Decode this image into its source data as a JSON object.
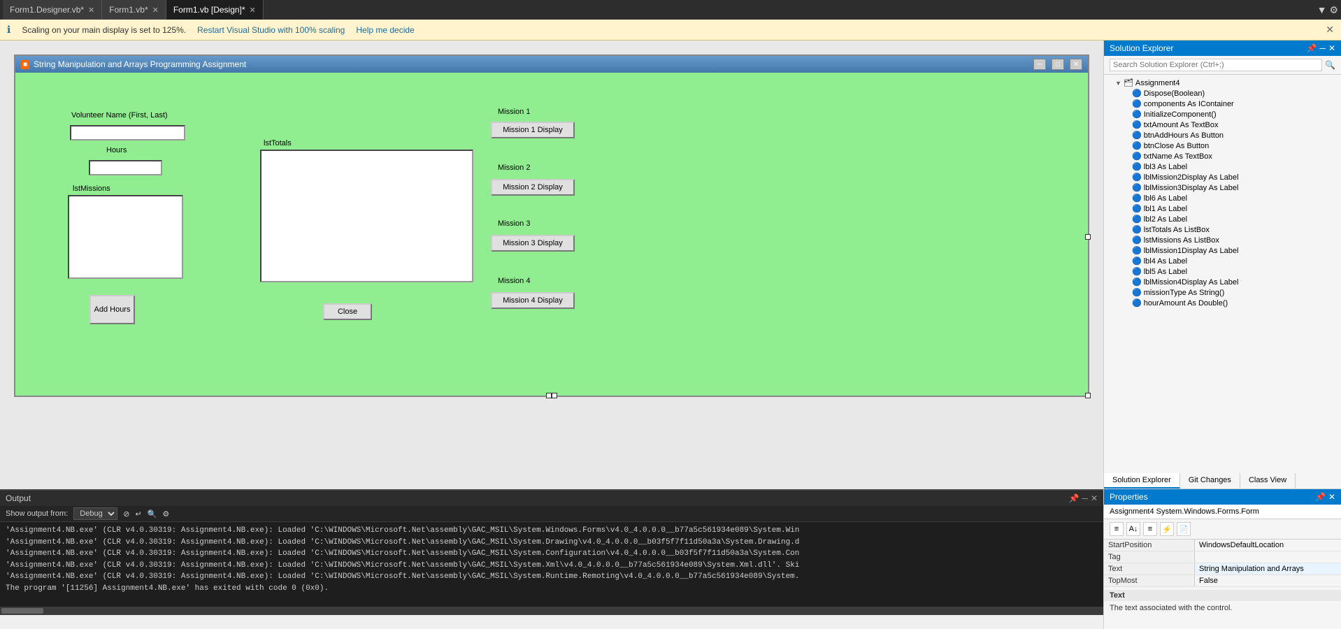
{
  "tabs": [
    {
      "label": "Form1.Designer.vb*",
      "active": false
    },
    {
      "label": "Form1.vb*",
      "active": false
    },
    {
      "label": "Form1.vb [Design]*",
      "active": true
    }
  ],
  "info_bar": {
    "message": "Scaling on your main display is set to 125%.",
    "link1": "Restart Visual Studio with 100% scaling",
    "link2": "Help me decide"
  },
  "form_window": {
    "title": "String Manipulation and Arrays Programming Assignment",
    "icon": "🟧"
  },
  "form_controls": {
    "volunteer_name_label": "Volunteer Name (First, Last)",
    "hours_label": "Hours",
    "lstMissions_label": "lstMissions",
    "lstTotals_label": "lstTotals",
    "mission1_label": "Mission 1",
    "mission2_label": "Mission 2",
    "mission3_label": "Mission 3",
    "mission4_label": "Mission 4",
    "mission1_btn": "Mission 1 Display",
    "mission2_btn": "Mission 2 Display",
    "mission3_btn": "Mission 3 Display",
    "mission4_btn": "Mission 4 Display",
    "add_hours_btn": "Add Hours",
    "close_btn": "Close"
  },
  "solution_explorer": {
    "title": "Solution Explorer",
    "search_placeholder": "Search Solution Explorer (Ctrl+;)",
    "tree_items": [
      {
        "label": "Assignment4",
        "indent": 1,
        "icon": "▶",
        "type": "solution"
      },
      {
        "label": "Dispose(Boolean)",
        "indent": 3,
        "icon": "🔵",
        "type": "method"
      },
      {
        "label": "components As IContainer",
        "indent": 3,
        "icon": "🔵",
        "type": "field"
      },
      {
        "label": "InitializeComponent()",
        "indent": 3,
        "icon": "🔵",
        "type": "method"
      },
      {
        "label": "txtAmount As TextBox",
        "indent": 3,
        "icon": "🔵",
        "type": "field"
      },
      {
        "label": "btnAddHours As Button",
        "indent": 3,
        "icon": "🔵",
        "type": "field"
      },
      {
        "label": "btnClose As Button",
        "indent": 3,
        "icon": "🔵",
        "type": "field"
      },
      {
        "label": "txtName As TextBox",
        "indent": 3,
        "icon": "🔵",
        "type": "field"
      },
      {
        "label": "lbl3 As Label",
        "indent": 3,
        "icon": "🔵",
        "type": "field"
      },
      {
        "label": "lblMission2Display As Label",
        "indent": 3,
        "icon": "🔵",
        "type": "field"
      },
      {
        "label": "lblMission3Display As Label",
        "indent": 3,
        "icon": "🔵",
        "type": "field"
      },
      {
        "label": "lbl6 As Label",
        "indent": 3,
        "icon": "🔵",
        "type": "field"
      },
      {
        "label": "lbl1 As Label",
        "indent": 3,
        "icon": "🔵",
        "type": "field"
      },
      {
        "label": "lbl2 As Label",
        "indent": 3,
        "icon": "🔵",
        "type": "field"
      },
      {
        "label": "lstTotals As ListBox",
        "indent": 3,
        "icon": "🔵",
        "type": "field"
      },
      {
        "label": "lstMissions As ListBox",
        "indent": 3,
        "icon": "🔵",
        "type": "field"
      },
      {
        "label": "lblMission1Display As Label",
        "indent": 3,
        "icon": "🔵",
        "type": "field"
      },
      {
        "label": "lbl4 As Label",
        "indent": 3,
        "icon": "🔵",
        "type": "field"
      },
      {
        "label": "lbl5 As Label",
        "indent": 3,
        "icon": "🔵",
        "type": "field"
      },
      {
        "label": "lblMission4Display As Label",
        "indent": 3,
        "icon": "🔵",
        "type": "field"
      },
      {
        "label": "missionType As String()",
        "indent": 3,
        "icon": "🔵",
        "type": "field"
      },
      {
        "label": "hourAmount As Double()",
        "indent": 3,
        "icon": "🔵",
        "type": "field"
      }
    ]
  },
  "panel_tabs": [
    {
      "label": "Solution Explorer",
      "active": true
    },
    {
      "label": "Git Changes",
      "active": false
    },
    {
      "label": "Class View",
      "active": false
    }
  ],
  "properties": {
    "title": "Properties",
    "object_name": "Assignment4  System.Windows.Forms.Form",
    "rows": [
      {
        "name": "StartPosition",
        "value": "WindowsDefaultLocation"
      },
      {
        "name": "Tag",
        "value": ""
      },
      {
        "name": "Text",
        "value": "String Manipulation and Arrays"
      },
      {
        "name": "TopMost",
        "value": "False"
      }
    ],
    "section_label": "Text",
    "section_desc": "The text associated with the control."
  },
  "output": {
    "title": "Output",
    "source_label": "Show output from:",
    "source_value": "Debug",
    "lines": [
      "'Assignment4.NB.exe' (CLR v4.0.30319: Assignment4.NB.exe): Loaded 'C:\\WINDOWS\\Microsoft.Net\\assembly\\GAC_MSIL\\System.Windows.Forms\\v4.0_4.0.0.0__b77a5c561934e089\\System.Win",
      "'Assignment4.NB.exe' (CLR v4.0.30319: Assignment4.NB.exe): Loaded 'C:\\WINDOWS\\Microsoft.Net\\assembly\\GAC_MSIL\\System.Drawing\\v4.0_4.0.0.0__b03f5f7f11d50a3a\\System.Drawing.d",
      "'Assignment4.NB.exe' (CLR v4.0.30319: Assignment4.NB.exe): Loaded 'C:\\WINDOWS\\Microsoft.Net\\assembly\\GAC_MSIL\\System.Configuration\\v4.0_4.0.0.0__b03f5f7f11d50a3a\\System.Con",
      "'Assignment4.NB.exe' (CLR v4.0.30319: Assignment4.NB.exe): Loaded 'C:\\WINDOWS\\Microsoft.Net\\assembly\\GAC_MSIL\\System.Xml\\v4.0_4.0.0.0__b77a5c561934e089\\System.Xml.dll'. Ski",
      "'Assignment4.NB.exe' (CLR v4.0.30319: Assignment4.NB.exe): Loaded 'C:\\WINDOWS\\Microsoft.Net\\assembly\\GAC_MSIL\\System.Runtime.Remoting\\v4.0_4.0.0.0__b77a5c561934e089\\System.",
      "The program '[11256] Assignment4.NB.exe' has exited with code 0 (0x0)."
    ]
  }
}
